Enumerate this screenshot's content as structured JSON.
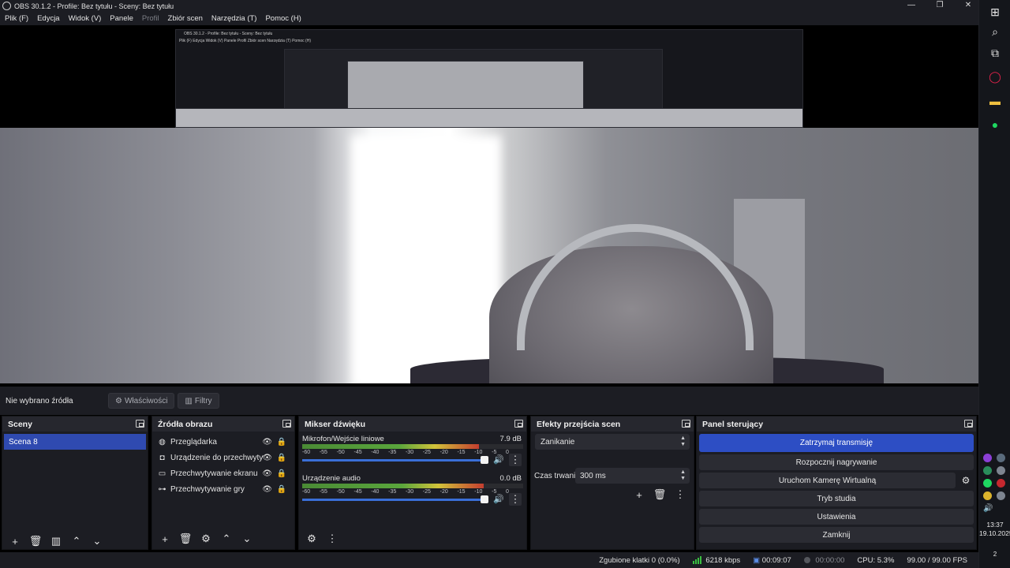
{
  "window": {
    "title": "OBS 30.1.2 - Profile: Bez tytułu - Sceny: Bez tytułu",
    "controls": [
      "—",
      "❐",
      "✕"
    ]
  },
  "menu": {
    "items": [
      "Plik (F)",
      "Edycja",
      "Widok (V)",
      "Panele",
      "Profil",
      "Zbiór scen",
      "Narzędzia (T)",
      "Pomoc (H)"
    ]
  },
  "preview": {
    "nested_title": "OBS 30.1.2 - Profile: Bez tytułu - Sceny: Bez tytułu",
    "nested_menu": "Plik (F)   Edycja   Widok (V)   Panele   Profil   Zbiór scen   Narzędzia (T)   Pomoc (H)"
  },
  "source_toolbar": {
    "no_source": "Nie wybrano źródła",
    "properties": "Właściwości",
    "filters": "Filtry"
  },
  "scenes": {
    "title": "Sceny",
    "items": [
      "Scena 8"
    ]
  },
  "sources": {
    "title": "Źródła obrazu",
    "items": [
      {
        "label": "Przeglądarka",
        "icon": "globe-icon"
      },
      {
        "label": "Urządzenie do przechwytywa",
        "icon": "camera-icon"
      },
      {
        "label": "Przechwytywanie ekranu",
        "icon": "monitor-icon"
      },
      {
        "label": "Przechwytywanie gry",
        "icon": "gamepad-icon"
      }
    ]
  },
  "mixer": {
    "title": "Mikser dźwięku",
    "channels": [
      {
        "name": "Mikrofon/Wejście liniowe",
        "db": "7.9 dB"
      },
      {
        "name": "Urządzenie audio",
        "db": "0.0 dB"
      }
    ],
    "ticks": [
      "-60",
      "-55",
      "-50",
      "-45",
      "-40",
      "-35",
      "-30",
      "-25",
      "-20",
      "-15",
      "-10",
      "-5",
      "0"
    ]
  },
  "transitions": {
    "title": "Efekty przejścia scen",
    "selected": "Zanikanie",
    "duration_label": "Czas trwania",
    "duration_value": "300 ms"
  },
  "controls": {
    "title": "Panel sterujący",
    "stop_stream": "Zatrzymaj transmisję",
    "start_recording": "Rozpocznij nagrywanie",
    "virtual_camera": "Uruchom Kamerę Wirtualną",
    "studio_mode": "Tryb studia",
    "settings": "Ustawienia",
    "exit": "Zamknij"
  },
  "status": {
    "dropped": "Zgubione klatki 0 (0.0%)",
    "kbps": "6218 kbps",
    "stream_time": "00:09:07",
    "rec_time": "00:00:00",
    "cpu": "CPU: 5.3%",
    "fps": "99.00 / 99.00 FPS"
  },
  "taskbar": {
    "time": "13:37",
    "date": "19.10.2025",
    "notifications": "2"
  },
  "colors": {
    "accent": "#2d4ec4",
    "scene_selected": "#2f4ab0",
    "panel_bg": "#1c1d23",
    "meter_green": "#5aa63c"
  }
}
